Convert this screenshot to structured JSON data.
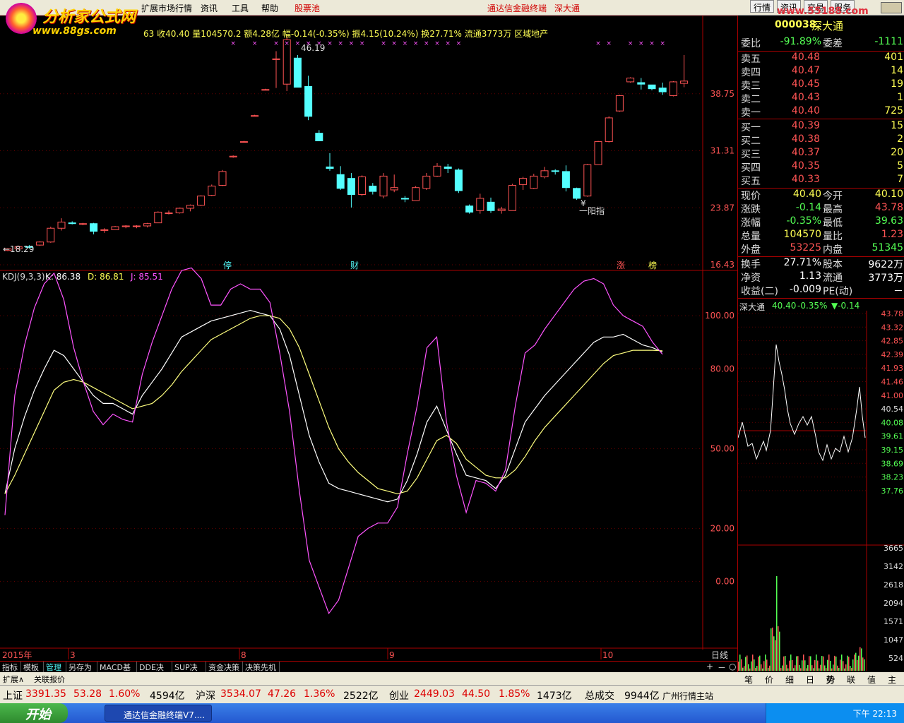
{
  "menu": {
    "items": [
      "扩展市场行情",
      "资讯",
      "工具",
      "帮助"
    ],
    "pool": "股票池",
    "title": "通达信金融终端",
    "title2": "深大通",
    "right": [
      "行情",
      "资讯",
      "交易",
      "服务"
    ]
  },
  "logo": {
    "name": "分析家公式网",
    "url": "www.88gs.com"
  },
  "watermark": "www.55188.com",
  "stock": {
    "code": "000038",
    "name": "深大通"
  },
  "info": "63 收40.40 量104570.2 额4.28亿 幅-0.14(-0.35%) 振4.15(10.24%) 换27.71% 流通3773万 区域地产",
  "price_axis": [
    "38.75",
    "31.31",
    "23.87",
    "16.43"
  ],
  "kline_labels": {
    "max": "46.19",
    "min": "←18.29",
    "note": "一阳指",
    "yen": "¥"
  },
  "markers": [
    {
      "t": "停",
      "c": "#54ffff"
    },
    {
      "t": "财",
      "c": "#54ffff"
    },
    {
      "t": "涨",
      "c": "#ff5454"
    },
    {
      "t": "榜",
      "c": "#ffff54"
    }
  ],
  "kdj_header": {
    "name": "KDJ(9,3,3)",
    "k": "K: 86.38",
    "d": "D: 86.81",
    "j": "J: 85.51"
  },
  "kdj_axis": [
    "100.00",
    "80.00",
    "50.00",
    "20.00",
    "0.00"
  ],
  "date_axis": {
    "year": "2015年",
    "labels": [
      "3",
      "8",
      "9",
      "10"
    ],
    "period": "日线"
  },
  "tabs": [
    "指标",
    "模板",
    "管理",
    "另存为",
    "MACD基本",
    "DDE决策",
    "SUP决策",
    "资金决策",
    "决策先机"
  ],
  "tabs2": [
    "扩展∧",
    "关联报价"
  ],
  "quote": {
    "weibi": {
      "l": "委比",
      "v": "-91.89%",
      "l2": "委差",
      "v2": "-1111"
    },
    "sell": [
      {
        "l": "卖五",
        "p": "40.48",
        "q": "401"
      },
      {
        "l": "卖四",
        "p": "40.47",
        "q": "14"
      },
      {
        "l": "卖三",
        "p": "40.45",
        "q": "19"
      },
      {
        "l": "卖二",
        "p": "40.43",
        "q": "1"
      },
      {
        "l": "卖一",
        "p": "40.40",
        "q": "725"
      }
    ],
    "buy": [
      {
        "l": "买一",
        "p": "40.39",
        "q": "15"
      },
      {
        "l": "买二",
        "p": "40.38",
        "q": "2"
      },
      {
        "l": "买三",
        "p": "40.37",
        "q": "20"
      },
      {
        "l": "买四",
        "p": "40.35",
        "q": "5"
      },
      {
        "l": "买五",
        "p": "40.33",
        "q": "7"
      }
    ],
    "stats": [
      {
        "l": "现价",
        "v": "40.40",
        "l2": "今开",
        "v2": "40.10"
      },
      {
        "l": "涨跌",
        "v": "-0.14",
        "l2": "最高",
        "v2": "43.78"
      },
      {
        "l": "涨幅",
        "v": "-0.35%",
        "l2": "最低",
        "v2": "39.63"
      },
      {
        "l": "总量",
        "v": "104570",
        "l2": "量比",
        "v2": "1.23"
      },
      {
        "l": "外盘",
        "v": "53225",
        "l2": "内盘",
        "v2": "51345"
      }
    ],
    "stats2": [
      {
        "l": "换手",
        "v": "27.71%",
        "l2": "股本",
        "v2": "9622万"
      },
      {
        "l": "净资",
        "v": "1.13",
        "l2": "流通",
        "v2": "3773万"
      },
      {
        "l": "收益(二)",
        "v": "-0.009",
        "l2": "PE(动)",
        "v2": "－"
      }
    ]
  },
  "intraday": {
    "title": "深大通",
    "price": "40.40",
    "chg": "-0.35%",
    "chg2": "▼-0.14",
    "axis": [
      "43.78",
      "43.32",
      "42.85",
      "42.39",
      "41.93",
      "41.46",
      "41.00",
      "40.54",
      "40.08",
      "39.61",
      "39.15",
      "38.69",
      "38.23",
      "37.76"
    ],
    "vol_axis": [
      "3665",
      "3142",
      "2618",
      "2094",
      "1571",
      "1047",
      "524"
    ]
  },
  "rtabs": [
    "笔",
    "价",
    "细",
    "日",
    "势",
    "联",
    "值",
    "主"
  ],
  "index_bar": [
    {
      "t": "上证",
      "c": "#000"
    },
    {
      "t": "3391.35",
      "c": "#d00"
    },
    {
      "t": "53.28",
      "c": "#d00"
    },
    {
      "t": "1.60%",
      "c": "#d00"
    },
    {
      "t": "4594亿",
      "c": "#000"
    },
    {
      "t": "沪深",
      "c": "#000"
    },
    {
      "t": "3534.07",
      "c": "#d00"
    },
    {
      "t": "47.26",
      "c": "#d00"
    },
    {
      "t": "1.36%",
      "c": "#d00"
    },
    {
      "t": "2522亿",
      "c": "#000"
    },
    {
      "t": "创业",
      "c": "#000"
    },
    {
      "t": "2449.03",
      "c": "#d00"
    },
    {
      "t": "44.50",
      "c": "#d00"
    },
    {
      "t": "1.85%",
      "c": "#d00"
    },
    {
      "t": "1473亿",
      "c": "#000"
    },
    {
      "t": "总成交",
      "c": "#000"
    },
    {
      "t": "9944亿",
      "c": "#000"
    },
    {
      "t": "广州行情主站",
      "c": "#000"
    }
  ],
  "taskbar": {
    "start": "开始",
    "item": "通达信金融终端V7....",
    "time": "下午 22:13"
  },
  "chart_data": [
    {
      "type": "candlestick",
      "title": "",
      "ylim": [
        16.43,
        46.19
      ],
      "candles": [
        [
          18.3,
          18.6,
          18.2,
          18.5
        ],
        [
          18.5,
          18.9,
          18.4,
          18.8
        ],
        [
          18.8,
          19.0,
          18.6,
          18.7
        ],
        [
          19.0,
          19.5,
          18.9,
          19.4
        ],
        [
          19.4,
          21.4,
          19.3,
          21.2
        ],
        [
          21.2,
          22.5,
          20.9,
          22.0
        ],
        [
          21.9,
          22.1,
          21.7,
          21.8
        ],
        [
          21.8,
          21.9,
          21.6,
          21.8
        ],
        [
          21.8,
          21.9,
          20.4,
          20.8
        ],
        [
          21.0,
          21.2,
          20.6,
          21.0
        ],
        [
          21.0,
          21.5,
          21.0,
          21.4
        ],
        [
          21.4,
          21.6,
          21.2,
          21.5
        ],
        [
          21.5,
          21.6,
          21.2,
          21.5
        ],
        [
          21.5,
          21.9,
          21.3,
          21.8
        ],
        [
          21.9,
          23.4,
          21.9,
          23.3
        ],
        [
          23.2,
          23.5,
          23.0,
          23.2
        ],
        [
          23.2,
          23.9,
          23.1,
          23.8
        ],
        [
          23.8,
          24.3,
          23.4,
          24.2
        ],
        [
          24.2,
          25.5,
          24.1,
          25.4
        ],
        [
          25.5,
          26.9,
          25.4,
          26.7
        ],
        [
          26.8,
          28.8,
          26.7,
          28.6
        ],
        [
          30.5,
          30.7,
          30.4,
          30.6
        ],
        [
          32.5,
          32.6,
          32.4,
          32.5
        ],
        [
          35.8,
          36.0,
          35.8,
          35.9
        ],
        [
          39.3,
          39.4,
          39.3,
          39.3
        ],
        [
          43.3,
          44.3,
          39.5,
          43.3
        ],
        [
          40.0,
          46.2,
          39.1,
          45.8
        ],
        [
          43.4,
          43.8,
          39.6,
          39.6
        ],
        [
          39.7,
          41.1,
          35.3,
          35.8
        ],
        [
          33.6,
          34.0,
          32.6,
          32.6
        ],
        [
          29.2,
          31.0,
          28.7,
          29.0
        ],
        [
          28.2,
          29.3,
          26.2,
          26.4
        ],
        [
          27.7,
          28.4,
          23.9,
          25.6
        ],
        [
          25.6,
          28.1,
          25.4,
          27.9
        ],
        [
          26.7,
          27.1,
          25.6,
          26.0
        ],
        [
          25.4,
          28.4,
          25.1,
          28.0
        ],
        [
          26.2,
          28.2,
          25.9,
          26.5
        ],
        [
          25.1,
          25.4,
          24.6,
          25.0
        ],
        [
          24.8,
          26.7,
          24.8,
          26.5
        ],
        [
          26.4,
          28.4,
          26.2,
          28.0
        ],
        [
          28.0,
          29.7,
          27.9,
          29.3
        ],
        [
          29.2,
          29.6,
          28.4,
          29.0
        ],
        [
          28.8,
          29.0,
          25.8,
          26.1
        ],
        [
          24.1,
          24.3,
          23.1,
          23.3
        ],
        [
          23.5,
          25.7,
          23.1,
          25.1
        ],
        [
          24.6,
          25.2,
          23.2,
          23.5
        ],
        [
          23.5,
          24.0,
          23.1,
          23.7
        ],
        [
          23.5,
          27.0,
          23.5,
          26.8
        ],
        [
          26.9,
          27.9,
          26.2,
          27.7
        ],
        [
          26.4,
          28.3,
          26.3,
          28.0
        ],
        [
          27.9,
          29.2,
          27.7,
          28.7
        ],
        [
          28.7,
          28.9,
          28.2,
          28.6
        ],
        [
          28.6,
          29.4,
          26.0,
          26.5
        ],
        [
          26.4,
          26.5,
          24.9,
          25.1
        ],
        [
          25.4,
          29.6,
          25.3,
          29.5
        ],
        [
          29.5,
          32.6,
          29.5,
          32.5
        ],
        [
          32.5,
          35.8,
          32.4,
          35.6
        ],
        [
          36.5,
          38.6,
          36.4,
          38.5
        ],
        [
          40.3,
          40.9,
          40.2,
          40.8
        ],
        [
          40.2,
          40.8,
          39.3,
          40.0
        ],
        [
          39.9,
          39.9,
          39.2,
          39.4
        ],
        [
          39.5,
          40.2,
          38.6,
          39.0
        ],
        [
          38.5,
          40.4,
          38.4,
          40.3
        ],
        [
          40.1,
          43.8,
          39.6,
          40.4
        ]
      ]
    },
    {
      "type": "line",
      "title": "KDJ(9,3,3)",
      "ylim": [
        -24,
        112
      ],
      "series": [
        {
          "name": "K",
          "color": "#ffffff",
          "values": [
            33,
            50,
            62,
            72,
            80,
            87,
            85,
            80,
            75,
            70,
            67,
            67,
            65,
            63,
            70,
            75,
            80,
            86,
            92,
            94,
            96,
            98,
            99,
            100,
            101,
            102,
            101,
            100,
            95,
            85,
            70,
            55,
            45,
            37,
            35,
            34,
            33,
            32,
            31,
            30,
            31,
            38,
            48,
            60,
            66,
            57,
            48,
            40,
            39,
            38,
            35,
            40,
            50,
            60,
            65,
            70,
            74,
            78,
            82,
            86,
            90,
            92,
            92,
            93,
            91,
            89,
            88,
            86.38
          ]
        },
        {
          "name": "D",
          "color": "#ffff7f",
          "values": [
            33,
            40,
            48,
            56,
            64,
            72,
            75,
            76,
            75,
            73,
            71,
            69,
            67,
            65,
            66,
            67,
            70,
            74,
            79,
            83,
            87,
            91,
            93,
            95,
            97,
            99,
            100,
            100,
            99,
            95,
            88,
            78,
            68,
            58,
            50,
            45,
            41,
            38,
            35,
            34,
            33,
            34,
            39,
            46,
            53,
            55,
            52,
            46,
            43,
            40,
            39,
            39,
            42,
            47,
            53,
            58,
            62,
            66,
            70,
            74,
            78,
            82,
            85,
            86,
            87,
            87,
            87,
            86.81
          ]
        },
        {
          "name": "J",
          "color": "#ff54ff",
          "values": [
            25,
            70,
            89,
            103,
            112,
            116,
            106,
            88,
            75,
            64,
            59,
            63,
            61,
            60,
            78,
            90,
            100,
            110,
            117,
            118,
            114,
            104,
            104,
            110,
            112,
            110,
            110,
            105,
            86,
            64,
            34,
            8,
            -2,
            -12,
            -7,
            5,
            17,
            20,
            22,
            22,
            28,
            48,
            66,
            88,
            92,
            60,
            40,
            26,
            38,
            37,
            34,
            42,
            66,
            86,
            89,
            95,
            100,
            105,
            110,
            113,
            114,
            112,
            104,
            100,
            98,
            96,
            90,
            85.51
          ]
        }
      ]
    }
  ]
}
